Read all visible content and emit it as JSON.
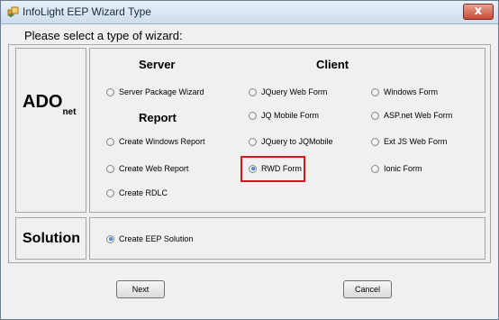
{
  "window": {
    "title": "InfoLight EEP Wizard Type",
    "close_glyph": "x"
  },
  "prompt": "Please select a type of wizard:",
  "ado_label": {
    "main": "ADO",
    "sub": "net"
  },
  "solution_label": "Solution",
  "sections": {
    "server": "Server",
    "client": "Client",
    "report": "Report"
  },
  "options": {
    "server_package_wizard": "Server Package Wizard",
    "create_windows_report": "Create Windows Report",
    "create_web_report": "Create Web Report",
    "create_rdlc": "Create RDLC",
    "jquery_web_form": "JQuery Web Form",
    "jq_mobile_form": "JQ Mobile Form",
    "jquery_to_jqmobile": "JQuery to JQMobile",
    "rwd_form": "RWD Form",
    "windows_form": "Windows Form",
    "aspnet_web_form": "ASP.net Web Form",
    "extjs_web_form": "Ext JS Web Form",
    "ionic_form": "Ionic Form",
    "create_eep_solution": "Create EEP Solution"
  },
  "selected": [
    "rwd_form",
    "create_eep_solution"
  ],
  "buttons": {
    "next": "Next",
    "cancel": "Cancel"
  },
  "colors": {
    "highlight": "#d6141a",
    "radio_checked": "#1b5eb4"
  }
}
